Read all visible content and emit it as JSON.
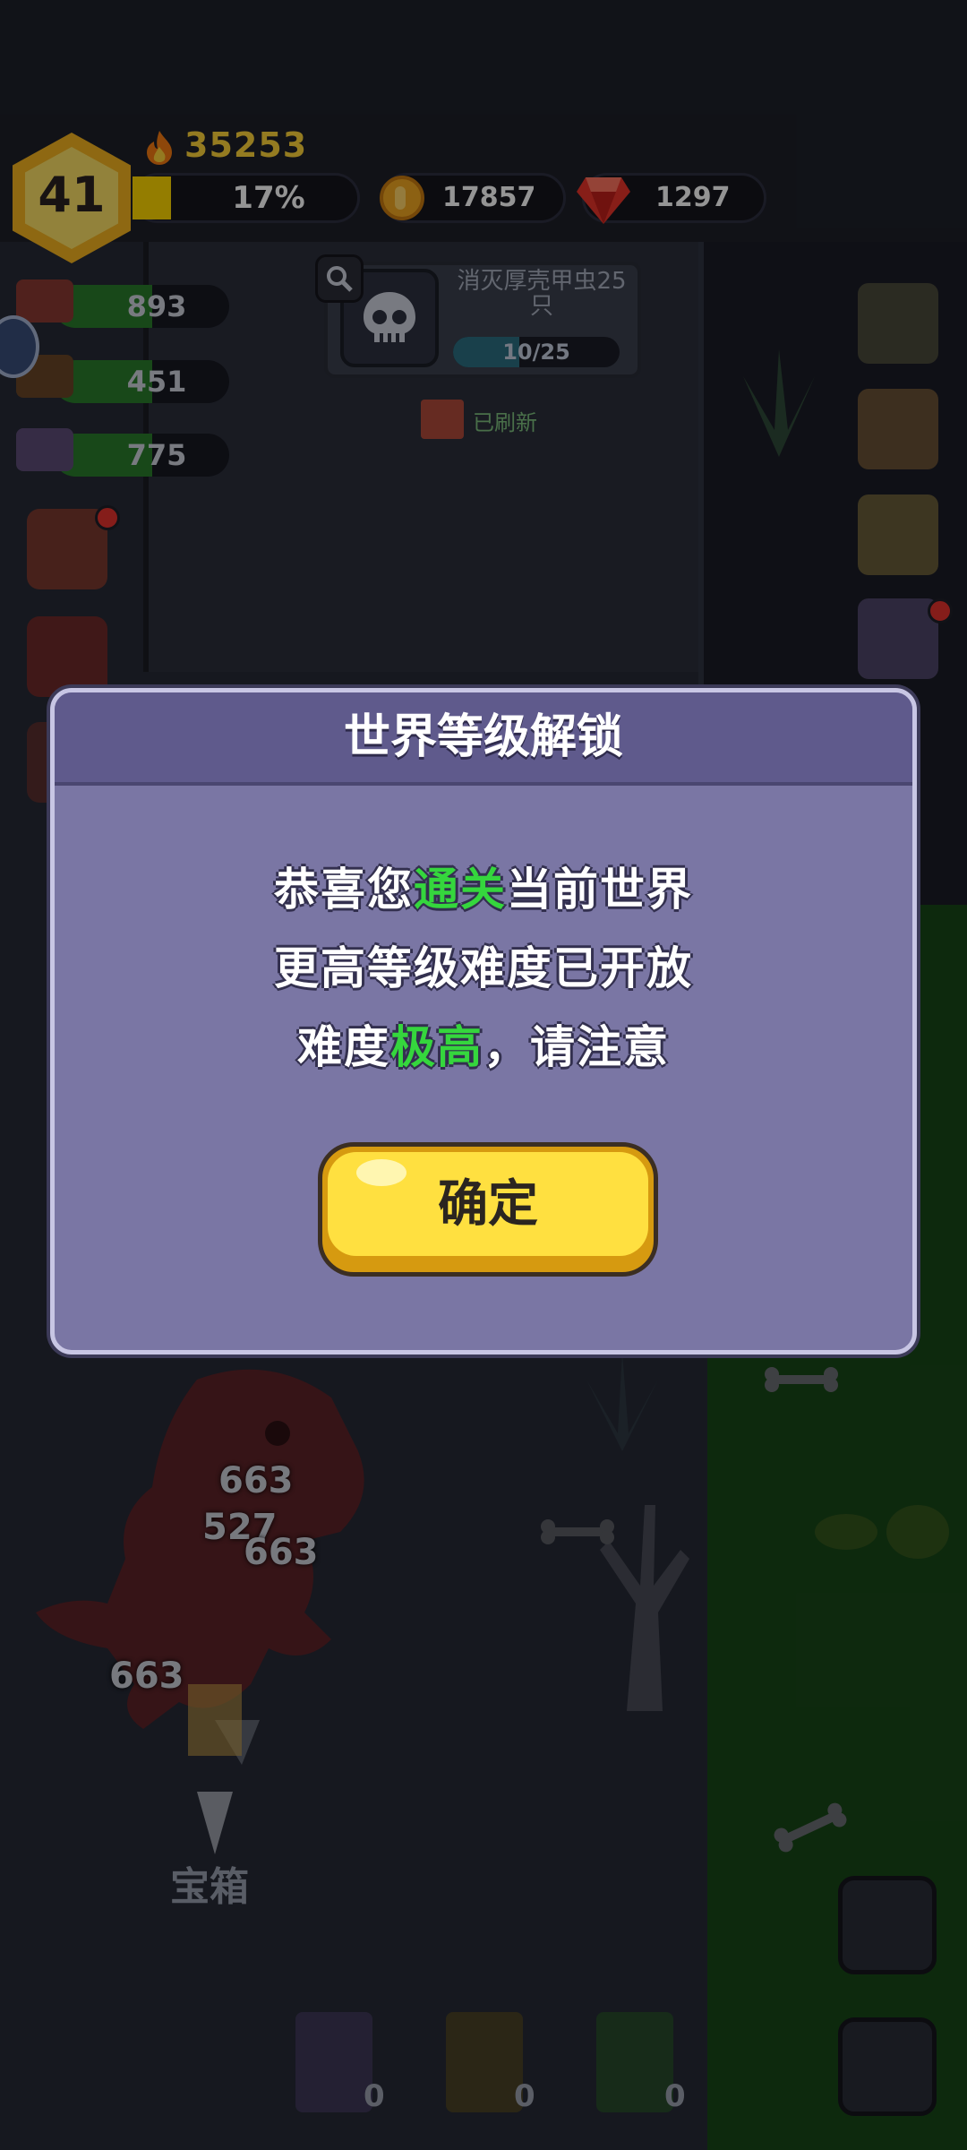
{
  "hud": {
    "level": "41",
    "power": "35253",
    "xp_percent_text": "17%",
    "xp_progress": 0.17,
    "coins": "17857",
    "gems": "1297"
  },
  "side_resources": [
    {
      "name": "meat",
      "value": "893"
    },
    {
      "name": "wood",
      "value": "451"
    },
    {
      "name": "ore",
      "value": "775"
    }
  ],
  "quest": {
    "title": "消灭厚壳甲虫25只",
    "progress_text": "10/25",
    "refresh_text": "已刷新"
  },
  "damage_numbers": [
    "663",
    "527",
    "663",
    "663"
  ],
  "chest_label": "宝箱",
  "books": [
    {
      "icon": "lightning-book-icon",
      "count": "0"
    },
    {
      "icon": "wing-book-icon",
      "count": "0"
    },
    {
      "icon": "heal-book-icon",
      "count": "0"
    }
  ],
  "modal": {
    "title": "世界等级解锁",
    "line1_a": "恭喜您",
    "line1_b": "通关",
    "line1_c": "当前世界",
    "line2": "更高等级难度已开放",
    "line3_a": "难度",
    "line3_b": "极高",
    "line3_c": "，请注意",
    "confirm_label": "确定"
  },
  "colors": {
    "modal_bg": "#7a76a4",
    "modal_header": "#5f5a8c",
    "highlight_green": "#35d63d",
    "button_yellow": "#ffe040",
    "power_gold": "#ffd43a"
  }
}
